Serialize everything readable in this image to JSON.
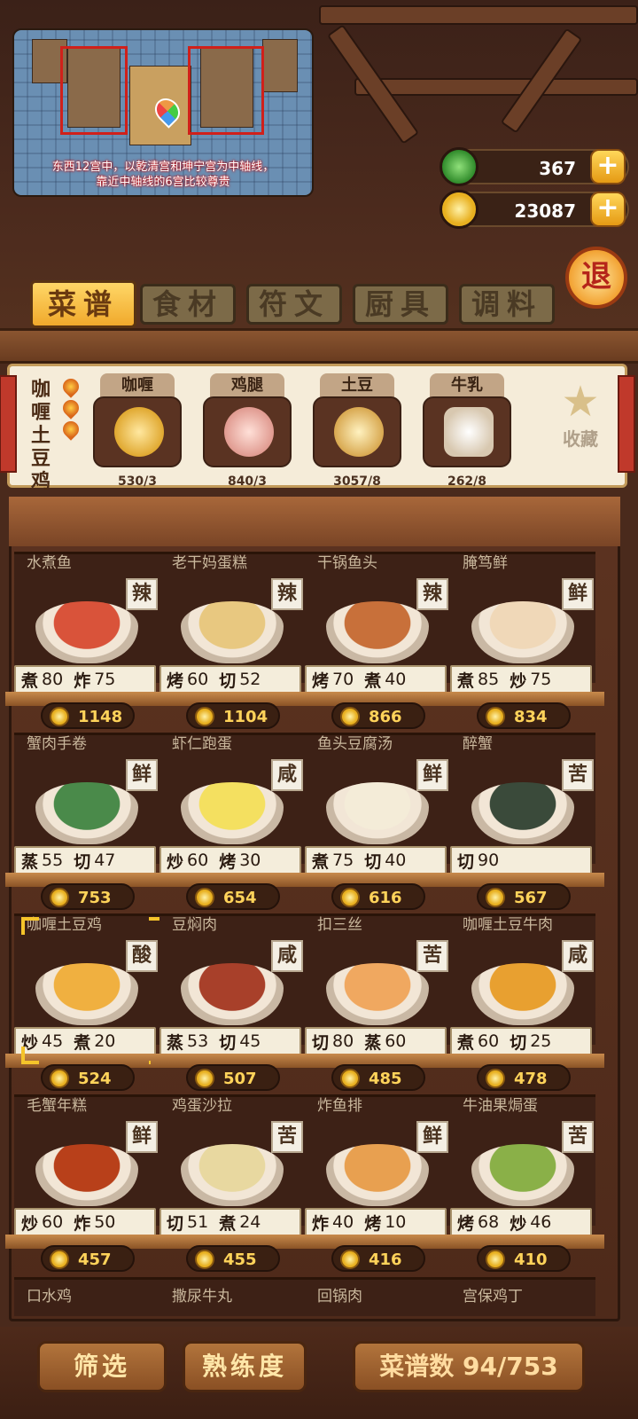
{
  "map_overlay": {
    "caption_line1": "东西12宫中，以乾清宫和坤宁宫为中轴线，",
    "caption_line2": "靠近中轴线的6宫比较尊贵"
  },
  "currencies": [
    {
      "name": "jade",
      "value": "367",
      "color": "#3fae3a"
    },
    {
      "name": "coins",
      "value": "23087",
      "color": "#e8b020"
    }
  ],
  "plus_label": "+",
  "exit_label": "退",
  "tabs": [
    {
      "label": "菜谱",
      "active": true
    },
    {
      "label": "食材",
      "active": false
    },
    {
      "label": "符文",
      "active": false
    },
    {
      "label": "厨具",
      "active": false
    },
    {
      "label": "调料",
      "active": false
    }
  ],
  "selected_recipe": {
    "name": "咖喱土豆鸡",
    "flames": 3,
    "ingredients": [
      {
        "name": "咖喱",
        "count": "530/3",
        "color": "#f0c050"
      },
      {
        "name": "鸡腿",
        "count": "840/3",
        "color": "#f0b8b0"
      },
      {
        "name": "土豆",
        "count": "3057/8",
        "color": "#e8c870"
      },
      {
        "name": "牛乳",
        "count": "262/8",
        "color": "#f4ece0"
      }
    ],
    "favorite_label": "收藏"
  },
  "recipes": [
    {
      "name": "水煮鱼",
      "flavor": "辣",
      "skills": [
        [
          "煮",
          "80"
        ],
        [
          "炸",
          "75"
        ]
      ],
      "price": "1148",
      "color": "#d9533a"
    },
    {
      "name": "老干妈蛋糕",
      "flavor": "辣",
      "skills": [
        [
          "烤",
          "60"
        ],
        [
          "切",
          "52"
        ]
      ],
      "price": "1104",
      "color": "#e8c880"
    },
    {
      "name": "干锅鱼头",
      "flavor": "辣",
      "skills": [
        [
          "烤",
          "70"
        ],
        [
          "煮",
          "40"
        ]
      ],
      "price": "866",
      "color": "#c8703a"
    },
    {
      "name": "腌笃鲜",
      "flavor": "鲜",
      "skills": [
        [
          "煮",
          "85"
        ],
        [
          "炒",
          "75"
        ]
      ],
      "price": "834",
      "color": "#f0d8b8"
    },
    {
      "name": "蟹肉手卷",
      "flavor": "鲜",
      "skills": [
        [
          "蒸",
          "55"
        ],
        [
          "切",
          "47"
        ]
      ],
      "price": "753",
      "color": "#4a8a4a"
    },
    {
      "name": "虾仁跑蛋",
      "flavor": "咸",
      "skills": [
        [
          "炒",
          "60"
        ],
        [
          "烤",
          "30"
        ]
      ],
      "price": "654",
      "color": "#f4e060"
    },
    {
      "name": "鱼头豆腐汤",
      "flavor": "鲜",
      "skills": [
        [
          "煮",
          "75"
        ],
        [
          "切",
          "40"
        ]
      ],
      "price": "616",
      "color": "#f4ecd8"
    },
    {
      "name": "醉蟹",
      "flavor": "苦",
      "skills": [
        [
          "切",
          "90"
        ]
      ],
      "price": "567",
      "color": "#3a4a3a"
    },
    {
      "name": "咖喱土豆鸡",
      "flavor": "酸",
      "skills": [
        [
          "炒",
          "45"
        ],
        [
          "煮",
          "20"
        ]
      ],
      "price": "524",
      "color": "#f0b040",
      "selected": true
    },
    {
      "name": "豆焖肉",
      "flavor": "咸",
      "skills": [
        [
          "蒸",
          "53"
        ],
        [
          "切",
          "45"
        ]
      ],
      "price": "507",
      "color": "#a8402a"
    },
    {
      "name": "扣三丝",
      "flavor": "苦",
      "skills": [
        [
          "切",
          "80"
        ],
        [
          "蒸",
          "60"
        ]
      ],
      "price": "485",
      "color": "#f0a860"
    },
    {
      "name": "咖喱土豆牛肉",
      "flavor": "咸",
      "skills": [
        [
          "煮",
          "60"
        ],
        [
          "切",
          "25"
        ]
      ],
      "price": "478",
      "color": "#e8a030"
    },
    {
      "name": "毛蟹年糕",
      "flavor": "鲜",
      "skills": [
        [
          "炒",
          "60"
        ],
        [
          "炸",
          "50"
        ]
      ],
      "price": "457",
      "color": "#b8401a"
    },
    {
      "name": "鸡蛋沙拉",
      "flavor": "苦",
      "skills": [
        [
          "切",
          "51"
        ],
        [
          "煮",
          "24"
        ]
      ],
      "price": "455",
      "color": "#e8d8a0"
    },
    {
      "name": "炸鱼排",
      "flavor": "鲜",
      "skills": [
        [
          "炸",
          "40"
        ],
        [
          "烤",
          "10"
        ]
      ],
      "price": "416",
      "color": "#e8a050"
    },
    {
      "name": "牛油果焗蛋",
      "flavor": "苦",
      "skills": [
        [
          "烤",
          "68"
        ],
        [
          "炒",
          "46"
        ]
      ],
      "price": "410",
      "color": "#8ab048"
    }
  ],
  "partial_recipes": [
    "口水鸡",
    "撒尿牛丸",
    "回锅肉",
    "宫保鸡丁"
  ],
  "bottom": {
    "filter_label": "筛选",
    "proficiency_label": "熟练度",
    "count_label": "菜谱数 94/753"
  }
}
